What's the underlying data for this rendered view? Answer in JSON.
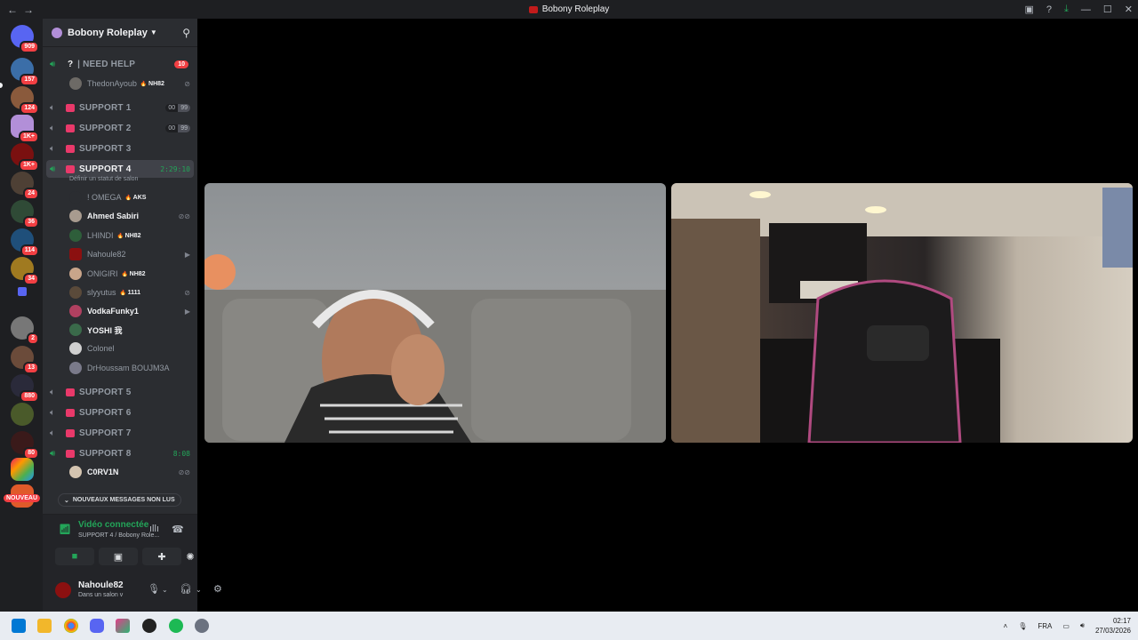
{
  "window": {
    "title": "Bobony Roleplay",
    "back": "←",
    "forward": "→"
  },
  "server_rail": {
    "badges": [
      "909",
      "157",
      "124",
      "1K+",
      "1K+",
      "24",
      "36",
      "114",
      "34",
      "2",
      "13",
      "880",
      "80"
    ],
    "new_label": "NOUVEAU"
  },
  "guild": {
    "name": "Bobony Roleplay"
  },
  "channels": [
    {
      "name": "| NEED HELP",
      "count": "10"
    },
    {
      "name": "SUPPORT 1",
      "pill_a": "00",
      "pill_b": "99"
    },
    {
      "name": "SUPPORT 2",
      "pill_a": "00",
      "pill_b": "99"
    },
    {
      "name": "SUPPORT 3"
    },
    {
      "name": "SUPPORT 4",
      "timer": "2:29:10",
      "status": "Définir un statut de salon"
    },
    {
      "name": "SUPPORT 5"
    },
    {
      "name": "SUPPORT 6"
    },
    {
      "name": "SUPPORT 7"
    },
    {
      "name": "SUPPORT 8",
      "timer": "8:08"
    }
  ],
  "help_users": [
    {
      "name": "ThedonAyoub",
      "tag": "NH82"
    }
  ],
  "support4_users": [
    {
      "name": "! OMEGA",
      "tag": "AKS"
    },
    {
      "name": "Ahmed Sabiri"
    },
    {
      "name": "LHINDI",
      "tag": "NH82"
    },
    {
      "name": "Nahoule82"
    },
    {
      "name": "ONIGIRI",
      "tag": "NH82"
    },
    {
      "name": "slyyutus",
      "tag": "1111"
    },
    {
      "name": "VodkaFunky1"
    },
    {
      "name": "YOSHI 我"
    },
    {
      "name": "Colonel"
    },
    {
      "name": "DrHoussam BOUJM3A"
    }
  ],
  "support8_users": [
    {
      "name": "C0RV1N"
    }
  ],
  "unread_label": "NOUVEAUX MESSAGES NON LUS",
  "voice": {
    "title": "Vidéo connectée",
    "subtitle": "SUPPORT 4 / Bobony Role..."
  },
  "me": {
    "name": "Nahoule82",
    "status": "Dans un salon v"
  },
  "taskbar": {
    "lang": "FRA",
    "time": "02:17",
    "date": "27/03/2026"
  },
  "colors": {
    "accent_green": "#23a559",
    "badge_red": "#f23f43",
    "sidebar": "#2b2d31",
    "rail": "#1e1f22"
  }
}
